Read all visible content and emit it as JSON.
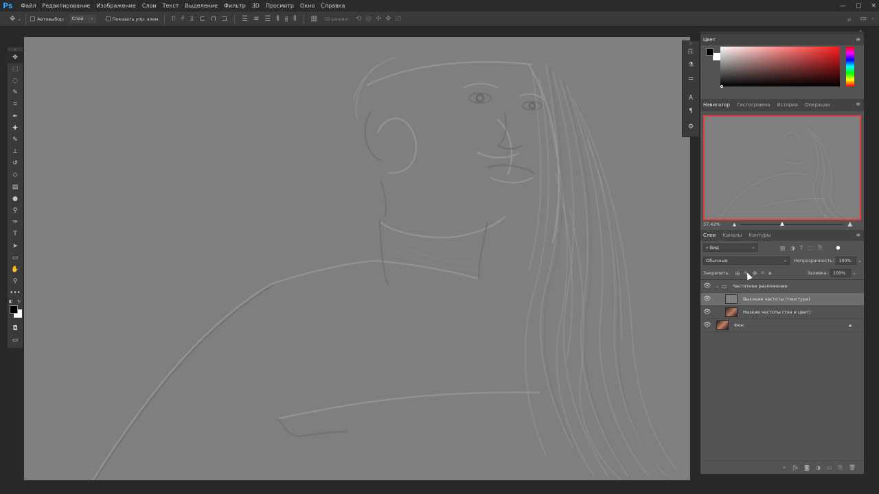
{
  "app": {
    "logo": "Ps"
  },
  "menu": [
    "Файл",
    "Редактирование",
    "Изображение",
    "Слои",
    "Текст",
    "Выделение",
    "Фильтр",
    "3D",
    "Просмотр",
    "Окно",
    "Справка"
  ],
  "options": {
    "autoselect_label": "Автовыбор:",
    "autoselect_value": "Слой",
    "show_controls_label": "Показать упр. элем.",
    "mode3d_label": "3D-режим:"
  },
  "tools": [
    "move-tool-icon",
    "marquee-tool-icon",
    "lasso-tool-icon",
    "quick-selection-icon",
    "crop-tool-icon",
    "eyedropper-icon",
    "healing-brush-icon",
    "brush-tool-icon",
    "clone-stamp-icon",
    "history-brush-icon",
    "eraser-icon",
    "gradient-tool-icon",
    "blur-tool-icon",
    "dodge-tool-icon",
    "pen-tool-icon",
    "type-tool-icon",
    "path-selection-icon",
    "rectangle-tool-icon",
    "hand-tool-icon",
    "zoom-tool-icon",
    "more-tools-icon"
  ],
  "color_panel": {
    "title": "Цвет",
    "foreground": "#000000",
    "background": "#ffffff"
  },
  "navigator": {
    "tabs": [
      "Навигатор",
      "Гистограмма",
      "История",
      "Операции"
    ],
    "active_tab": "Навигатор",
    "zoom": "37,42%"
  },
  "layers_panel": {
    "tabs": [
      "Слои",
      "Каналы",
      "Контуры"
    ],
    "active_tab": "Слои",
    "filter_kind": "Вид",
    "blend_mode": "Обычные",
    "opacity_label": "Непрозрачность:",
    "opacity_value": "100%",
    "lock_label": "Закрепить:",
    "fill_label": "Заливка:",
    "fill_value": "100%",
    "group_name": "Частотное разложение",
    "layers": [
      {
        "name": "Высокие частоты (текстура)",
        "selected": true
      },
      {
        "name": "Низкие частоты (тон и цвет)",
        "selected": false
      }
    ],
    "background_layer": "Фон"
  },
  "colors": {
    "accent": "#31a8ff",
    "canvas_gray": "#7f7f7f",
    "panel_bg": "#535353",
    "nav_frame": "#e04040"
  }
}
